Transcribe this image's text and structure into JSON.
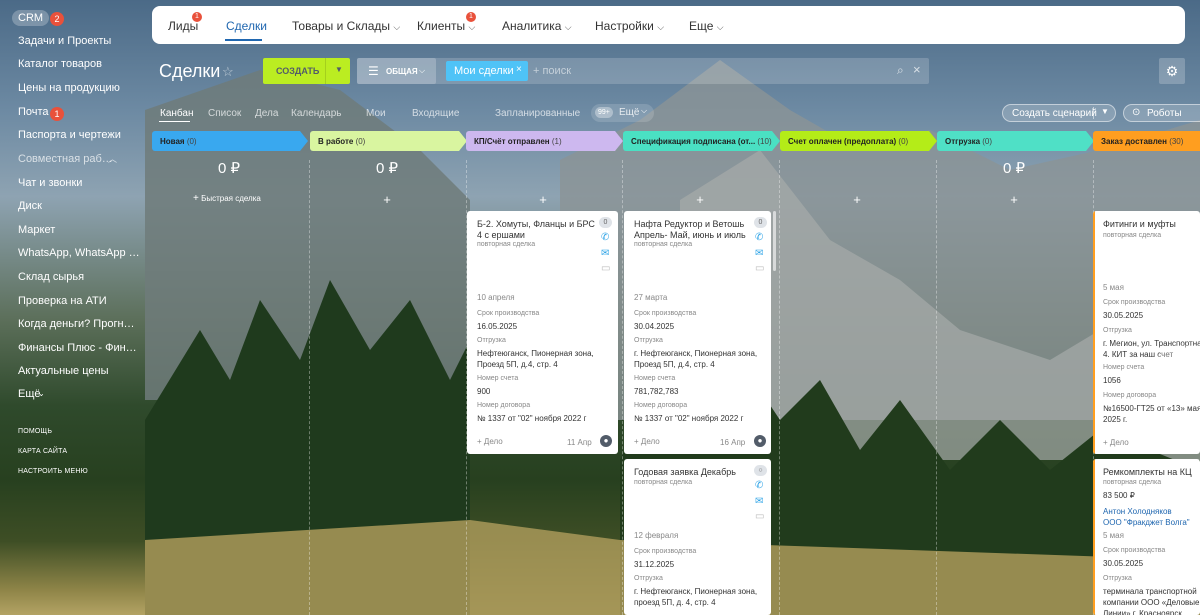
{
  "left_menu": {
    "crm": "CRM",
    "crm_badge": "2",
    "items": [
      "Задачи и Проекты",
      "Каталог товаров",
      "Цены на продукцию",
      "Почта",
      "Паспорта и чертежи",
      "Совместная работа",
      "Чат и звонки",
      "Диск",
      "Маркет",
      "WhatsApp, WhatsApp Bus...",
      "Склад сырья",
      "Проверка на АТИ",
      "Когда деньги? Прогноз о...",
      "Финансы Плюс - Финанс...",
      "Актуальные цены",
      "Ещё"
    ],
    "mail_badge": "1",
    "help": "ПОМОЩЬ",
    "sitemap": "КАРТА САЙТА",
    "configure": "НАСТРОИТЬ МЕНЮ"
  },
  "topnav": {
    "items": [
      "Лиды",
      "Сделки",
      "Товары и Склады",
      "Клиенты",
      "Аналитика",
      "Настройки",
      "Еще"
    ],
    "badges": {
      "leads": "1",
      "clients": "1"
    }
  },
  "toolbar": {
    "title": "Сделки",
    "create": "СОЗДАТЬ",
    "preset": "ОБЩАЯ",
    "filter_tag": "Мои сделки",
    "search_placeholder": "+ поиск"
  },
  "view_tabs": {
    "items": [
      "Канбан",
      "Список",
      "Дела",
      "Календарь",
      "Мои",
      "Входящие",
      "Запланированные",
      "Ещё"
    ],
    "badge": "99+",
    "scenario": "Создать сценарий",
    "robots": "Роботы"
  },
  "stages": [
    {
      "name": "Новая",
      "count": "(0)",
      "color": "#39a8ef",
      "sum": "0 ₽"
    },
    {
      "name": "В работе",
      "count": "(0)",
      "color": "#d9f5a0",
      "sum": "0 ₽"
    },
    {
      "name": "КП/Счёт отправлен",
      "count": "(1)",
      "color": "#cdb8ef",
      "sum": ""
    },
    {
      "name": "Спецификация подписана (от...",
      "count": "(10)",
      "color": "#4ae0c3",
      "sum": ""
    },
    {
      "name": "Счет оплачен (предоплата)",
      "count": "(0)",
      "color": "#b4ec18",
      "sum": ""
    },
    {
      "name": "Отгрузка",
      "count": "(0)",
      "color": "#4fe0c6",
      "sum": "0 ₽"
    },
    {
      "name": "Заказ доставлен",
      "count": "(30)",
      "color": "#ff9e1f",
      "sum": ""
    }
  ],
  "quick_deal": "Быстрая сделка",
  "cards": {
    "c1": {
      "title": "Б-2. Хомуты, Фланцы и БРС 4 с ершами",
      "sub": "повторная сделка",
      "counter": "0",
      "date": "10 апреля",
      "l1": "Срок производства",
      "v1": "16.05.2025",
      "l2": "Отгрузка",
      "v2": "Нефтеюганск, Пионерная зона, Проезд 5П, д.4, стр. 4",
      "l3": "Номер счета",
      "v3": "900",
      "l4": "Номер договора",
      "v4": "№ 1337 от \"02\" ноября 2022 г",
      "add": "+ Дело",
      "activity": "11 Апр"
    },
    "c2": {
      "title": "Нафта Редуктор и Ветошь Апрель- Май, июнь и июль",
      "sub": "повторная сделка",
      "counter": "0",
      "date": "27 марта",
      "l1": "Срок производства",
      "v1": "30.04.2025",
      "l2": "Отгрузка",
      "v2": "г. Нефтеюганск, Пионерная зона, Проезд 5П, д.4, стр. 4",
      "l3": "Номер счета",
      "v3": "781,782,783",
      "l4": "Номер договора",
      "v4": "№ 1337 от \"02\" ноября 2022 г",
      "add": "+ Дело",
      "activity": "16 Апр"
    },
    "c3": {
      "title": "Годовая заявка Декабрь",
      "sub": "повторная сделка",
      "date": "12 февраля",
      "l1": "Срок производства",
      "v1": "31.12.2025",
      "l2": "Отгрузка",
      "v2": "г. Нефтеюганск, Пионерная зона, проезд 5П, д. 4, стр. 4"
    },
    "c4": {
      "title": "Фитинги и муфты",
      "sub": "повторная сделка",
      "date": "5 мая",
      "l1": "Срок производства",
      "v1": "30.05.2025",
      "l2": "Отгрузка",
      "v2": "г. Мегион, ул. Транспортная 4. КИТ за наш счет",
      "l3": "Номер счета",
      "v3": "1056",
      "l4": "Номер договора",
      "v4": "№16500-ГТ25 от «13» мая 2025 г.",
      "add": "+ Дело"
    },
    "c5": {
      "title": "Ремкомплекты на КЦ",
      "sub": "повторная сделка",
      "amount": "83 500 ₽",
      "contact": "Антон Холодняков",
      "company": "ООО \"Фракджет Волга\"",
      "date": "5 мая",
      "l1": "Срок производства",
      "v1": "30.05.2025",
      "l2": "Отгрузка",
      "v2": "терминала транспортной компании ООО «Деловые Линии» г. Красноярск"
    }
  }
}
